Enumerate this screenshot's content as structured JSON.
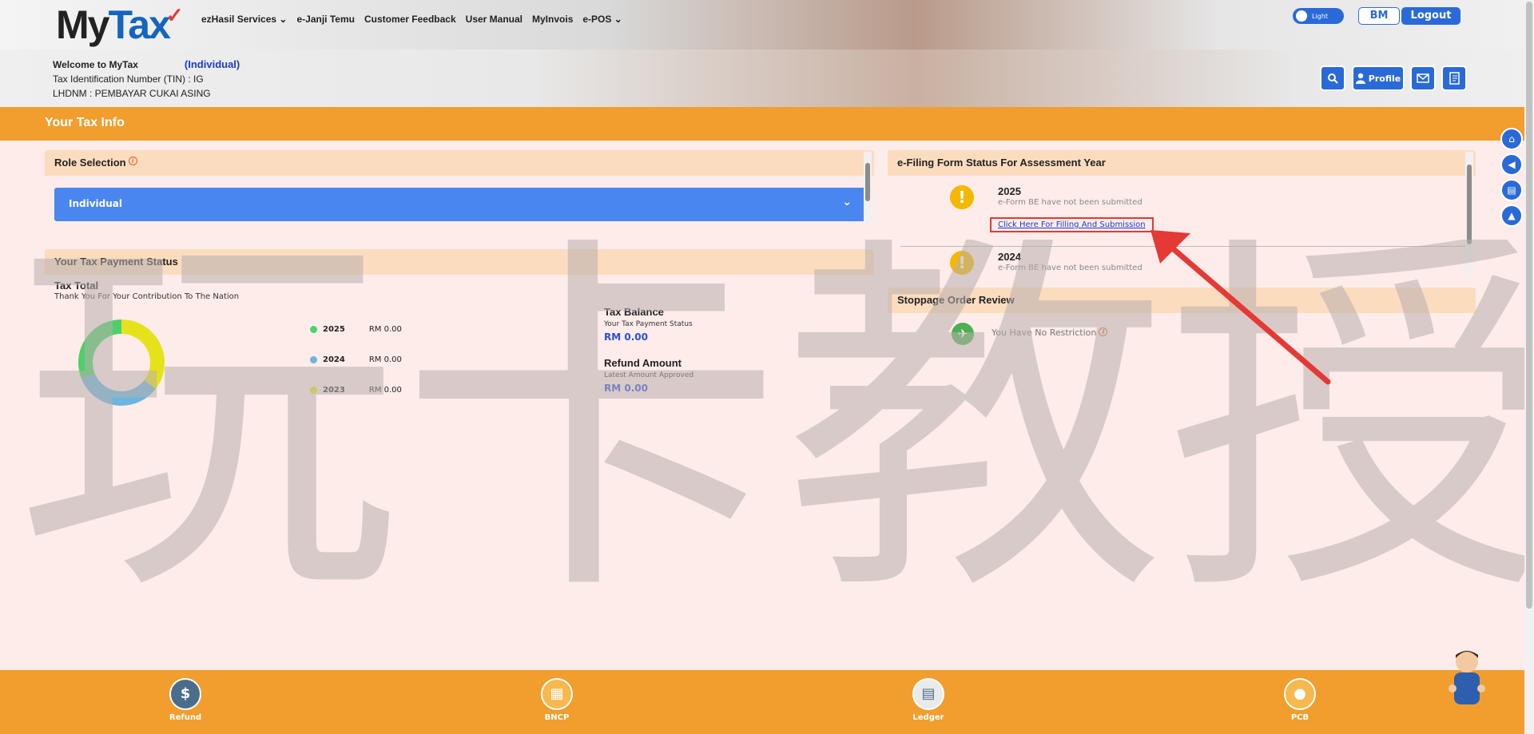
{
  "header": {
    "logo": {
      "my": "My",
      "tax": "Tax",
      "tick": "✓"
    },
    "nav": [
      "ezHasil Services",
      "e-Janji Temu",
      "Customer Feedback",
      "User Manual",
      "MyInvois",
      "e-POS"
    ],
    "theme_toggle_label": "Light",
    "lang_button": "BM",
    "logout_button": "Logout",
    "profile_button": "Profile"
  },
  "welcome": {
    "greeting": "Welcome to MyTax",
    "role": "(Individual)",
    "tin_line": "Tax Identification Number (TIN) : IG",
    "office_line": "LHDNM : PEMBAYAR CUKAI ASING"
  },
  "taxinfo_title": "Your Tax Info",
  "role_selection": {
    "title": "Role Selection",
    "info_mark": "i",
    "selected": "Individual"
  },
  "payment_status": {
    "title": "Your Tax Payment Status",
    "tax_total_title": "Tax Total",
    "tax_total_sub": "Thank You For Your Contribution To The Nation",
    "legend": [
      {
        "year": "2025",
        "amount": "RM 0.00",
        "color": "#4cd06a"
      },
      {
        "year": "2024",
        "amount": "RM 0.00",
        "color": "#6bb5e0"
      },
      {
        "year": "2023",
        "amount": "RM 0.00",
        "color": "#e6e21a"
      }
    ],
    "tax_balance_title": "Tax Balance",
    "tax_balance_sub": "Your Tax Payment Status",
    "tax_balance_value": "RM 0.00",
    "refund_title": "Refund Amount",
    "refund_sub": "Latest Amount Approved",
    "refund_value": "RM 0.00"
  },
  "efiling": {
    "title": "e-Filing Form Status For Assessment Year",
    "warn_mark": "!",
    "rows": [
      {
        "year": "2025",
        "note": "e-Form BE have not been submitted",
        "link": "Click Here For Filling And Submission"
      },
      {
        "year": "2024",
        "note": "e-Form BE have not been submitted"
      }
    ]
  },
  "stoppage": {
    "title": "Stoppage Order Review",
    "message": "You Have No Restriction",
    "info_mark": "i"
  },
  "bottom_nav": [
    "Refund",
    "BNCP",
    "Ledger",
    "PCB"
  ],
  "watermark_text": "玩卡教授",
  "colors": {
    "primary_blue": "#2a6ad8",
    "orange_bar": "#f19e2e",
    "card_header": "#fcdcbf",
    "link_blue": "#1a3bcc",
    "annotation_red": "#e53935"
  },
  "icons": [
    "search-icon",
    "user-icon",
    "mail-icon",
    "notebook-icon",
    "home-icon",
    "megaphone-icon",
    "book-icon",
    "graduation-icon",
    "plane-icon",
    "warning-icon",
    "refund-icon",
    "bncp-icon",
    "ledger-icon",
    "pcb-icon"
  ]
}
